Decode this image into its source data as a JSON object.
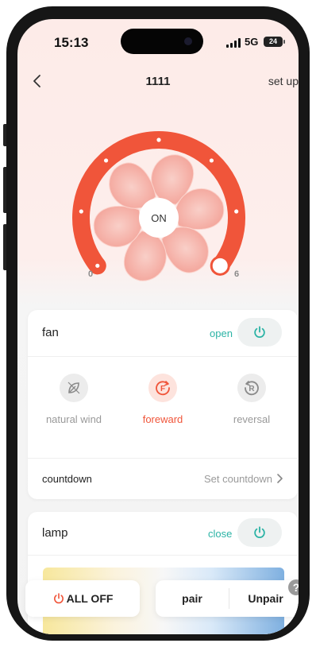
{
  "status_bar": {
    "time": "15:13",
    "network": "5G",
    "battery": "24"
  },
  "nav": {
    "title": "1111",
    "setup_label": "set up"
  },
  "dial": {
    "center_label": "ON",
    "min_label": "0",
    "max_label": "6",
    "level": 6,
    "max": 6
  },
  "fan": {
    "label": "fan",
    "state": "open",
    "modes": [
      {
        "label": "natural wind",
        "icon": "leaf-icon",
        "active": false
      },
      {
        "label": "foreward",
        "icon": "forward-f-icon",
        "active": true
      },
      {
        "label": "reversal",
        "icon": "reverse-r-icon",
        "active": false
      }
    ],
    "countdown_label": "countdown",
    "countdown_link": "Set countdown"
  },
  "lamp": {
    "label": "lamp",
    "state": "close"
  },
  "bottom": {
    "all_off_label": "ALL OFF",
    "pair_label": "pair",
    "unpair_label": "Unpair",
    "help_glyph": "?"
  },
  "colors": {
    "accent": "#f0553a",
    "teal": "#2bb3a5",
    "fan_blade": "#f4a59b",
    "active_mode_bg": "#fde3dd"
  }
}
